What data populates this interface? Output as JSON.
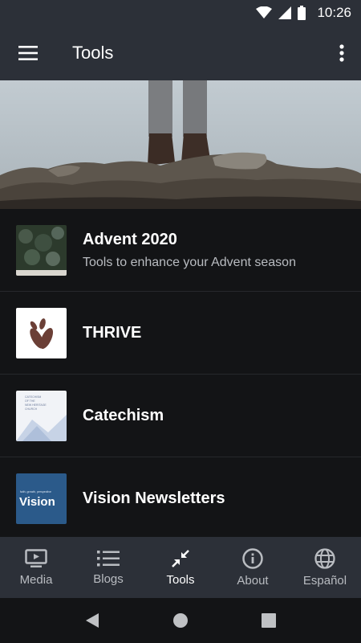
{
  "status": {
    "time": "10:26"
  },
  "app_bar": {
    "title": "Tools"
  },
  "items": [
    {
      "title": "Advent 2020",
      "subtitle": "Tools to enhance your Advent season"
    },
    {
      "title": "THRIVE"
    },
    {
      "title": "Catechism",
      "thumb_text": [
        "CATECHISM",
        "OF THE",
        "NEW HERITAGE",
        "CHURCH"
      ]
    },
    {
      "title": "Vision Newsletters",
      "thumb_small": "faith, growth, perspective",
      "thumb_big": "Vision"
    }
  ],
  "nav": [
    {
      "label": "Media",
      "icon": "tv-icon"
    },
    {
      "label": "Blogs",
      "icon": "list-icon"
    },
    {
      "label": "Tools",
      "icon": "compress-arrows-icon",
      "active": true
    },
    {
      "label": "About",
      "icon": "info-icon"
    },
    {
      "label": "Español",
      "icon": "globe-icon"
    }
  ],
  "colors": {
    "bar": "#2c3038",
    "background": "#131416",
    "inactive": "#b9bcc1"
  }
}
